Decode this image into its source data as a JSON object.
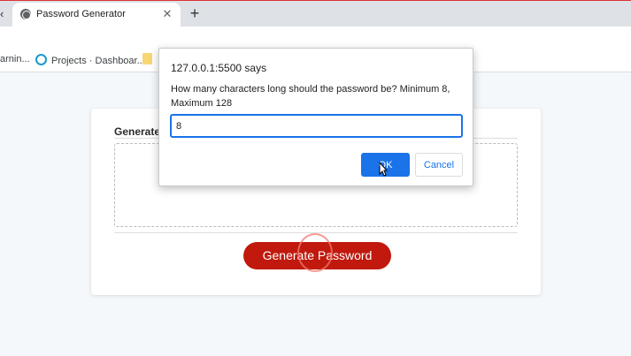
{
  "browser": {
    "tab": {
      "title": "Password Generator",
      "close_glyph": "✕",
      "favicon": "globe-icon"
    },
    "new_tab_glyph": "+",
    "back_glyph": "‹"
  },
  "bookmarks": [
    {
      "label": "arnin...",
      "icon": "none"
    },
    {
      "label": "Projects · Dashboar...",
      "icon": "projects-logo-icon"
    },
    {
      "label": "",
      "icon": "folder-icon"
    }
  ],
  "page": {
    "card_header": "Generate",
    "generate_button": "Generate Password"
  },
  "dialog": {
    "origin": "127.0.0.1:5500 says",
    "message": "How many characters long should the password be? Minimum 8, Maximum 128",
    "input_value": "8",
    "ok_label": "OK",
    "cancel_label": "Cancel"
  },
  "colors": {
    "accent": "#1a73e8",
    "generate_button": "#c1190d",
    "page_background": "#f4f8fa"
  }
}
